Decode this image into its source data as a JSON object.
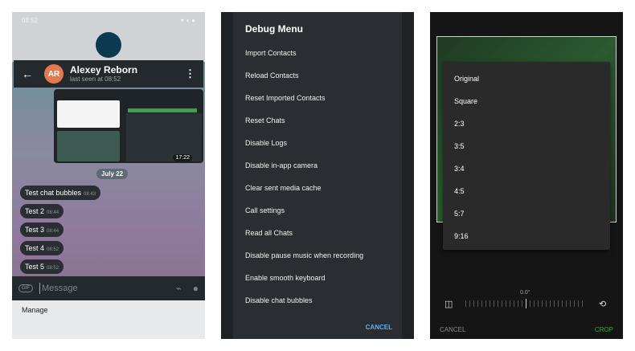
{
  "panel1": {
    "status_time": "08:52",
    "chat_name": "Alexey Reborn",
    "last_seen": "last seen at 08:52",
    "avatar_initials": "AR",
    "date_chip": "July 22",
    "embedded_time": "17:22",
    "messages": [
      {
        "text": "Test chat bubbles",
        "time": "08:43"
      },
      {
        "text": "Test 2",
        "time": "08:44"
      },
      {
        "text": "Test 3",
        "time": "08:44"
      },
      {
        "text": "Test 4",
        "time": "08:52"
      },
      {
        "text": "Test 5",
        "time": "08:52"
      }
    ],
    "input_placeholder": "Message",
    "gif_label": "GIF",
    "manage_label": "Manage"
  },
  "panel2": {
    "title": "Debug Menu",
    "items": [
      "Import Contacts",
      "Reload Contacts",
      "Reset Imported Contacts",
      "Reset Chats",
      "Disable Logs",
      "Disable in-app camera",
      "Clear sent media cache",
      "Call settings",
      "Read all Chats",
      "Disable pause music when recording",
      "Enable smooth keyboard",
      "Disable chat bubbles"
    ],
    "cancel_label": "CANCEL"
  },
  "panel3": {
    "ratios": [
      "Original",
      "Square",
      "2:3",
      "3:5",
      "3:4",
      "4:5",
      "5:7",
      "9:16"
    ],
    "rotation": "0.0°",
    "cancel_label": "CANCEL",
    "crop_label": "CROP"
  },
  "colors": {
    "telegram_blue": "#5fb0e8",
    "crop_green": "#3fa14a",
    "avatar_orange": "#e3794f"
  }
}
